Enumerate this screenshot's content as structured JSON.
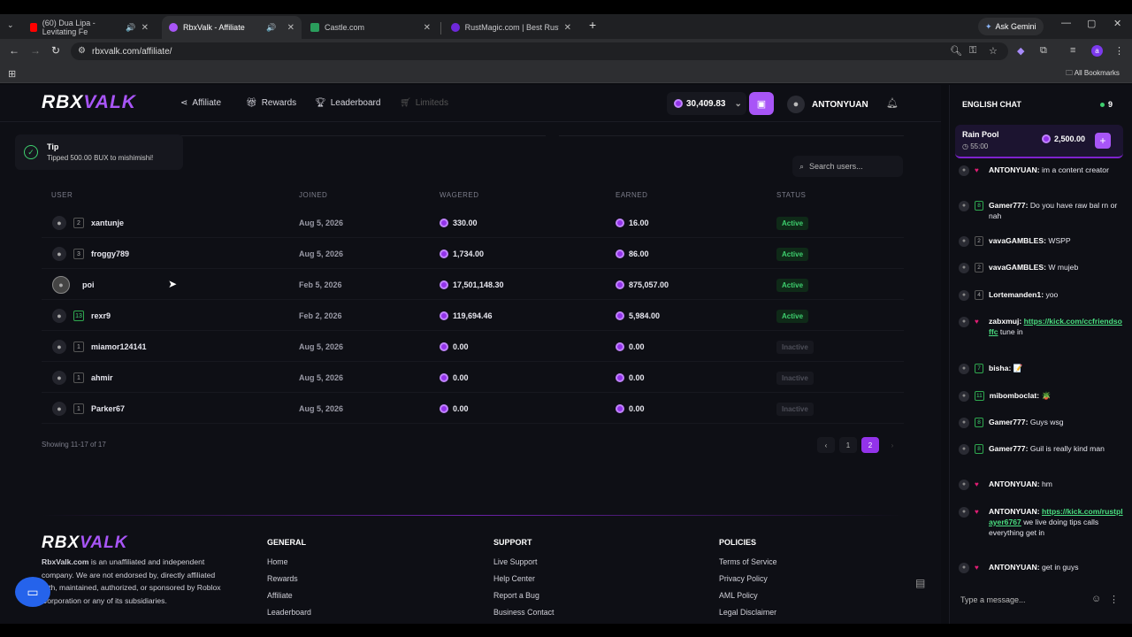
{
  "browser": {
    "tabs": [
      {
        "title": "(60) Dua Lipa - Levitating Fe",
        "color": "#ff0000"
      },
      {
        "title": "RbxValk - Affiliate",
        "color": "#a855f7"
      },
      {
        "title": "Castle.com",
        "color": "#2a9d5c"
      },
      {
        "title": "RustMagic.com | Best Rust Case",
        "color": "#6d28d9"
      }
    ],
    "gemini": "Ask Gemini",
    "url": "rbxvalk.com/affiliate/",
    "all_bookmarks": "All Bookmarks"
  },
  "header": {
    "logo": {
      "a": "RBX",
      "b": "VALK"
    },
    "nav": [
      {
        "label": "Affiliate",
        "icon": "share-icon"
      },
      {
        "label": "Rewards",
        "icon": "gift-icon"
      },
      {
        "label": "Leaderboard",
        "icon": "trophy-icon"
      },
      {
        "label": "Limiteds",
        "icon": "cart-icon"
      }
    ],
    "balance": "30,409.83",
    "username": "ANTONYUAN"
  },
  "toast": {
    "title": "Tip",
    "message": "Tipped 500.00 BUX to mishimishi!"
  },
  "search": {
    "placeholder": "Search users..."
  },
  "table": {
    "headers": {
      "user": "USER",
      "joined": "JOINED",
      "wagered": "WAGERED",
      "earned": "EARNED",
      "status": "STATUS"
    },
    "rows": [
      {
        "level": "2",
        "name": "xantunje",
        "joined": "Aug 5, 2026",
        "wagered": "330.00",
        "earned": "16.00",
        "status": "Active"
      },
      {
        "level": "3",
        "name": "froggy789",
        "joined": "Aug 5, 2026",
        "wagered": "1,734.00",
        "earned": "86.00",
        "status": "Active"
      },
      {
        "level": "",
        "name": "poi",
        "joined": "Feb 5, 2026",
        "wagered": "17,501,148.30",
        "earned": "875,057.00",
        "status": "Active"
      },
      {
        "level": "13",
        "name": "rexr9",
        "joined": "Feb 2, 2026",
        "wagered": "119,694.46",
        "earned": "5,984.00",
        "status": "Active"
      },
      {
        "level": "1",
        "name": "miamor124141",
        "joined": "Aug 5, 2026",
        "wagered": "0.00",
        "earned": "0.00",
        "status": "Inactive"
      },
      {
        "level": "1",
        "name": "ahmir",
        "joined": "Aug 5, 2026",
        "wagered": "0.00",
        "earned": "0.00",
        "status": "Inactive"
      },
      {
        "level": "1",
        "name": "Parker67",
        "joined": "Aug 5, 2026",
        "wagered": "0.00",
        "earned": "0.00",
        "status": "Inactive"
      }
    ],
    "showing": "Showing 11-17 of 17",
    "pages": [
      "1",
      "2"
    ],
    "current_page": "2"
  },
  "footer": {
    "description_bold": "RbxValk.com",
    "description": " is an unaffiliated and independent company. We are not endorsed by, directly affiliated with, maintained, authorized, or sponsored by Roblox Corporation or any of its subsidiaries.",
    "general": {
      "title": "GENERAL",
      "links": [
        "Home",
        "Rewards",
        "Affiliate",
        "Leaderboard"
      ]
    },
    "support": {
      "title": "SUPPORT",
      "links": [
        "Live Support",
        "Help Center",
        "Report a Bug",
        "Business Contact"
      ]
    },
    "policies": {
      "title": "POLICIES",
      "links": [
        "Terms of Service",
        "Privacy Policy",
        "AML Policy",
        "Legal Disclaimer"
      ]
    }
  },
  "chat": {
    "title": "ENGLISH CHAT",
    "online": "9",
    "rain": {
      "title": "Rain Pool",
      "timer": "55:00",
      "amount": "2,500.00"
    },
    "messages": [
      {
        "badge": "heart",
        "name": "ANTONYUAN:",
        "text": " im a content creator"
      },
      {
        "badge": "8",
        "green": true,
        "name": "Gamer777:",
        "text": " Do you have raw bal rn or nah"
      },
      {
        "badge": "2",
        "name": "vavaGAMBLES:",
        "text": " WSPP"
      },
      {
        "badge": "2",
        "name": "vavaGAMBLES:",
        "text": " W mujeb"
      },
      {
        "badge": "4",
        "name": "Lortemanden1:",
        "text": " yoo"
      },
      {
        "badge": "heart",
        "name": "zabxmuj:",
        "link": "https://kick.com/ccfriendsoffc",
        "text": " tune in"
      },
      {
        "badge": "7",
        "green": true,
        "name": "bisha:",
        "text": " 📝"
      },
      {
        "badge": "11",
        "green": true,
        "name": "mibomboclat:",
        "text": " 🪴"
      },
      {
        "badge": "8",
        "green": true,
        "name": "Gamer777:",
        "text": " Guys wsg"
      },
      {
        "badge": "8",
        "green": true,
        "name": "Gamer777:",
        "text": " Guil is really kind man"
      },
      {
        "badge": "heart",
        "name": "ANTONYUAN:",
        "text": " hm"
      },
      {
        "badge": "heart",
        "name": "ANTONYUAN:",
        "link": "https://kick.com/rustplayer6767",
        "text": " we live doing tips calls everything get in"
      },
      {
        "badge": "heart",
        "name": "ANTONYUAN:",
        "text": " get in guys"
      }
    ],
    "input_placeholder": "Type a message..."
  },
  "colors": {
    "accent": "#a855f7",
    "active": "#3ecf6e",
    "link": "#4ade80"
  }
}
